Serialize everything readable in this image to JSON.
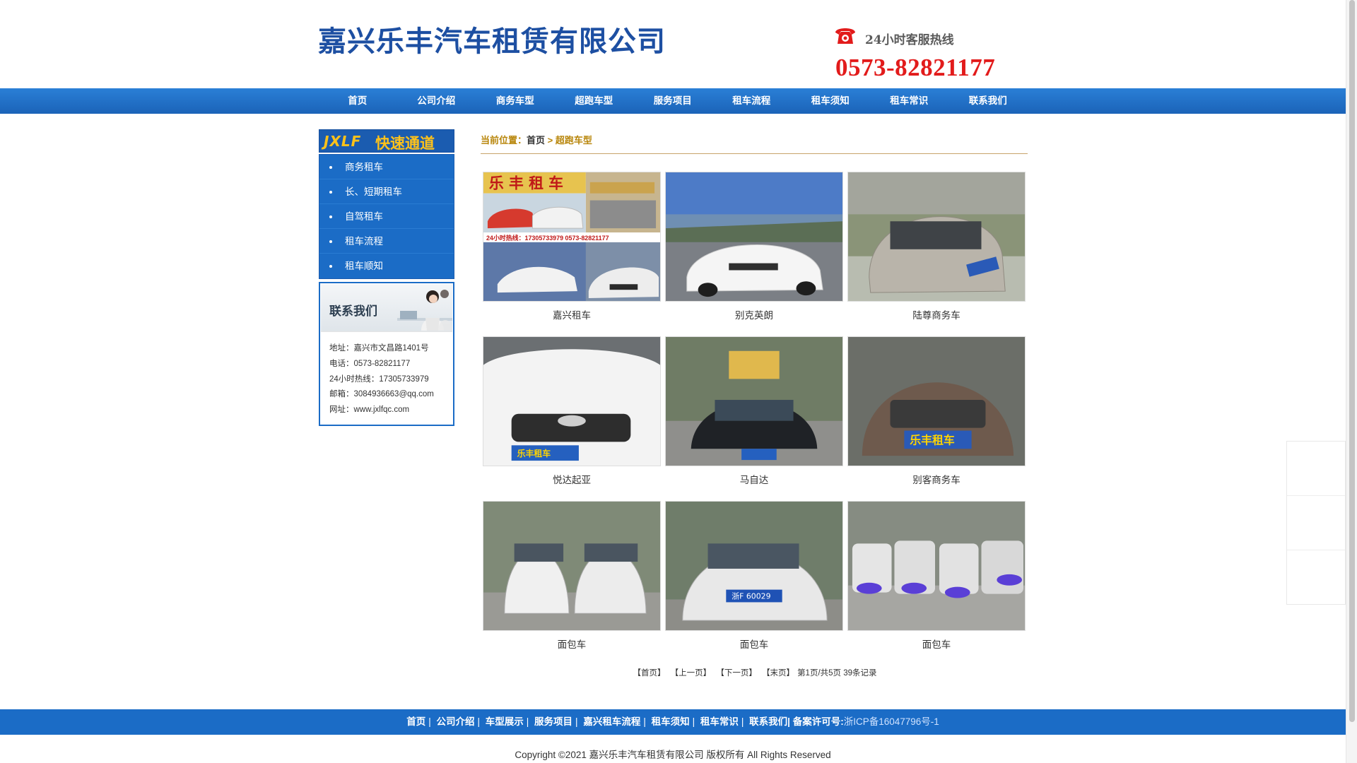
{
  "header": {
    "company": "嘉兴乐丰汽车租赁有限公司",
    "hotline_title": "24小时客服热线",
    "hotline_number": "0573-82821177"
  },
  "nav": [
    "首页",
    "公司介绍",
    "商务车型",
    "超跑车型",
    "服务项目",
    "租车流程",
    "租车须知",
    "租车常识",
    "联系我们"
  ],
  "sidebar": {
    "quick_logo": "JXLF",
    "quick_title": "快速通道",
    "quick_links": [
      "商务租车",
      "长、短期租车",
      "自驾租车",
      "租车流程",
      "租车顺知"
    ],
    "contact_title": "联系我们",
    "contact_lines": [
      "地址：嘉兴市文昌路1401号",
      "电话：0573-82821177",
      "24小时热线：17305733979",
      "邮箱：3084936663@qq.com",
      "网址：www.jxlfqc.com"
    ]
  },
  "breadcrumb": {
    "label": "当前位置：",
    "home": "首页",
    "separator": " > ",
    "current": "超跑车型"
  },
  "products": [
    {
      "name": "嘉兴租车",
      "photo": "collage-red-white-cars"
    },
    {
      "name": "别克英朗",
      "photo": "white-sedan-road"
    },
    {
      "name": "陆尊商务车",
      "photo": "silver-mpv"
    },
    {
      "name": "悦达起亚",
      "photo": "white-suv-front"
    },
    {
      "name": "马自达",
      "photo": "black-sedan-front"
    },
    {
      "name": "别客商务车",
      "photo": "brown-mpv-front"
    },
    {
      "name": "面包车",
      "photo": "two-minivans"
    },
    {
      "name": "面包车",
      "photo": "silver-minivan-front"
    },
    {
      "name": "面包车",
      "photo": "four-minivans"
    }
  ],
  "photo_text": {
    "collage_banner": "乐 丰 租 车",
    "collage_hotline": "24小时热线：17305733979    0573-82821177",
    "sticker": "乐丰租车",
    "plate": "浙F 60029"
  },
  "pager": {
    "first": "【首页】",
    "prev": "【上一页】",
    "next": "【下一页】",
    "last": "【末页】",
    "status": "第1页/共5页 39条记录"
  },
  "footer": {
    "links": [
      "首页",
      "公司介绍",
      "车型展示",
      "服务项目",
      "嘉兴租车流程",
      "租车须知",
      "租车常识",
      "联系我们"
    ],
    "icp_label": "备案许可号:",
    "icp": "浙ICP备16047796号-1",
    "copyright": "Copyright ©2021 嘉兴乐丰汽车租赁有限公司 版权所有 All Rights Reserved"
  },
  "colors": {
    "brand_blue": "#1d4fa2",
    "nav_blue": "#1b6cc6",
    "hotline_red": "#e21b1b",
    "accent_gold": "#b8860b",
    "quick_yellow": "#ffc21a"
  }
}
